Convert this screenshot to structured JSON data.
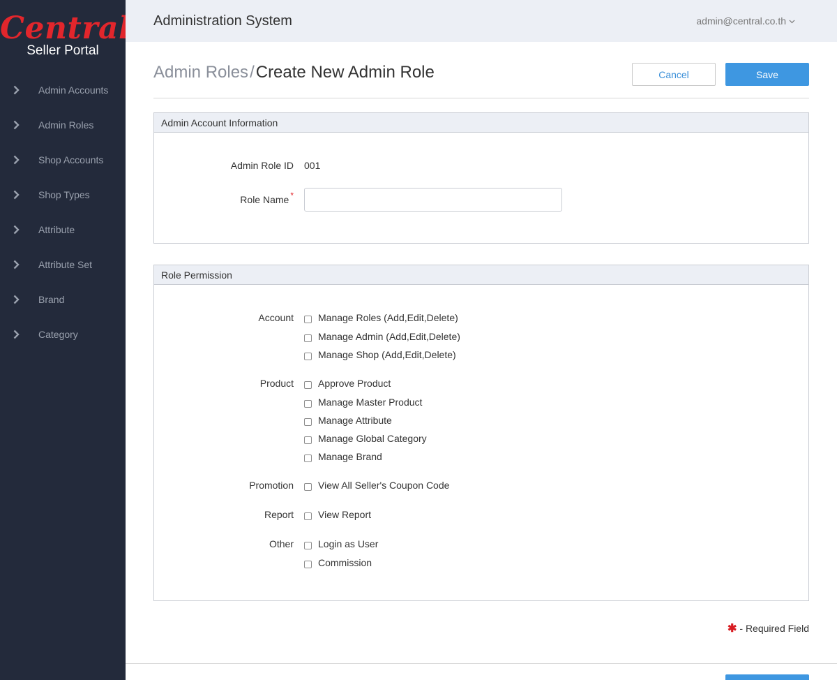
{
  "brand": {
    "logo_text": "Central",
    "subtitle": "Seller Portal"
  },
  "sidebar": {
    "items": [
      {
        "label": "Admin Accounts"
      },
      {
        "label": "Admin Roles"
      },
      {
        "label": "Shop Accounts"
      },
      {
        "label": "Shop Types"
      },
      {
        "label": "Attribute"
      },
      {
        "label": "Attribute Set"
      },
      {
        "label": "Brand"
      },
      {
        "label": "Category"
      }
    ]
  },
  "header": {
    "title": "Administration System",
    "user": "admin@central.co.th"
  },
  "page": {
    "breadcrumb_parent": "Admin Roles",
    "breadcrumb_sep": "/",
    "breadcrumb_current": "Create New Admin Role",
    "cancel_label": "Cancel",
    "save_label": "Save"
  },
  "info_panel": {
    "title": "Admin Account Information",
    "role_id_label": "Admin Role ID",
    "role_id_value": "001",
    "role_name_label": "Role Name",
    "required_mark": "*",
    "role_name_value": ""
  },
  "perm_panel": {
    "title": "Role Permission",
    "groups": [
      {
        "label": "Account",
        "options": [
          "Manage Roles (Add,Edit,Delete)",
          "Manage Admin (Add,Edit,Delete)",
          "Manage Shop (Add,Edit,Delete)"
        ]
      },
      {
        "label": "Product",
        "options": [
          "Approve Product",
          "Manage Master Product",
          "Manage Attribute",
          "Manage Global Category",
          "Manage Brand"
        ]
      },
      {
        "label": "Promotion",
        "options": [
          "View All Seller's Coupon Code"
        ]
      },
      {
        "label": "Report",
        "options": [
          "View Report"
        ]
      },
      {
        "label": "Other",
        "options": [
          "Login as User",
          "Commission"
        ]
      }
    ]
  },
  "required_note": {
    "symbol": "✱",
    "text": "- Required Field"
  },
  "colors": {
    "sidebar_bg": "#232a3b",
    "brand_red": "#e2262c",
    "primary": "#3e97e1",
    "header_bg": "#eceff5"
  }
}
